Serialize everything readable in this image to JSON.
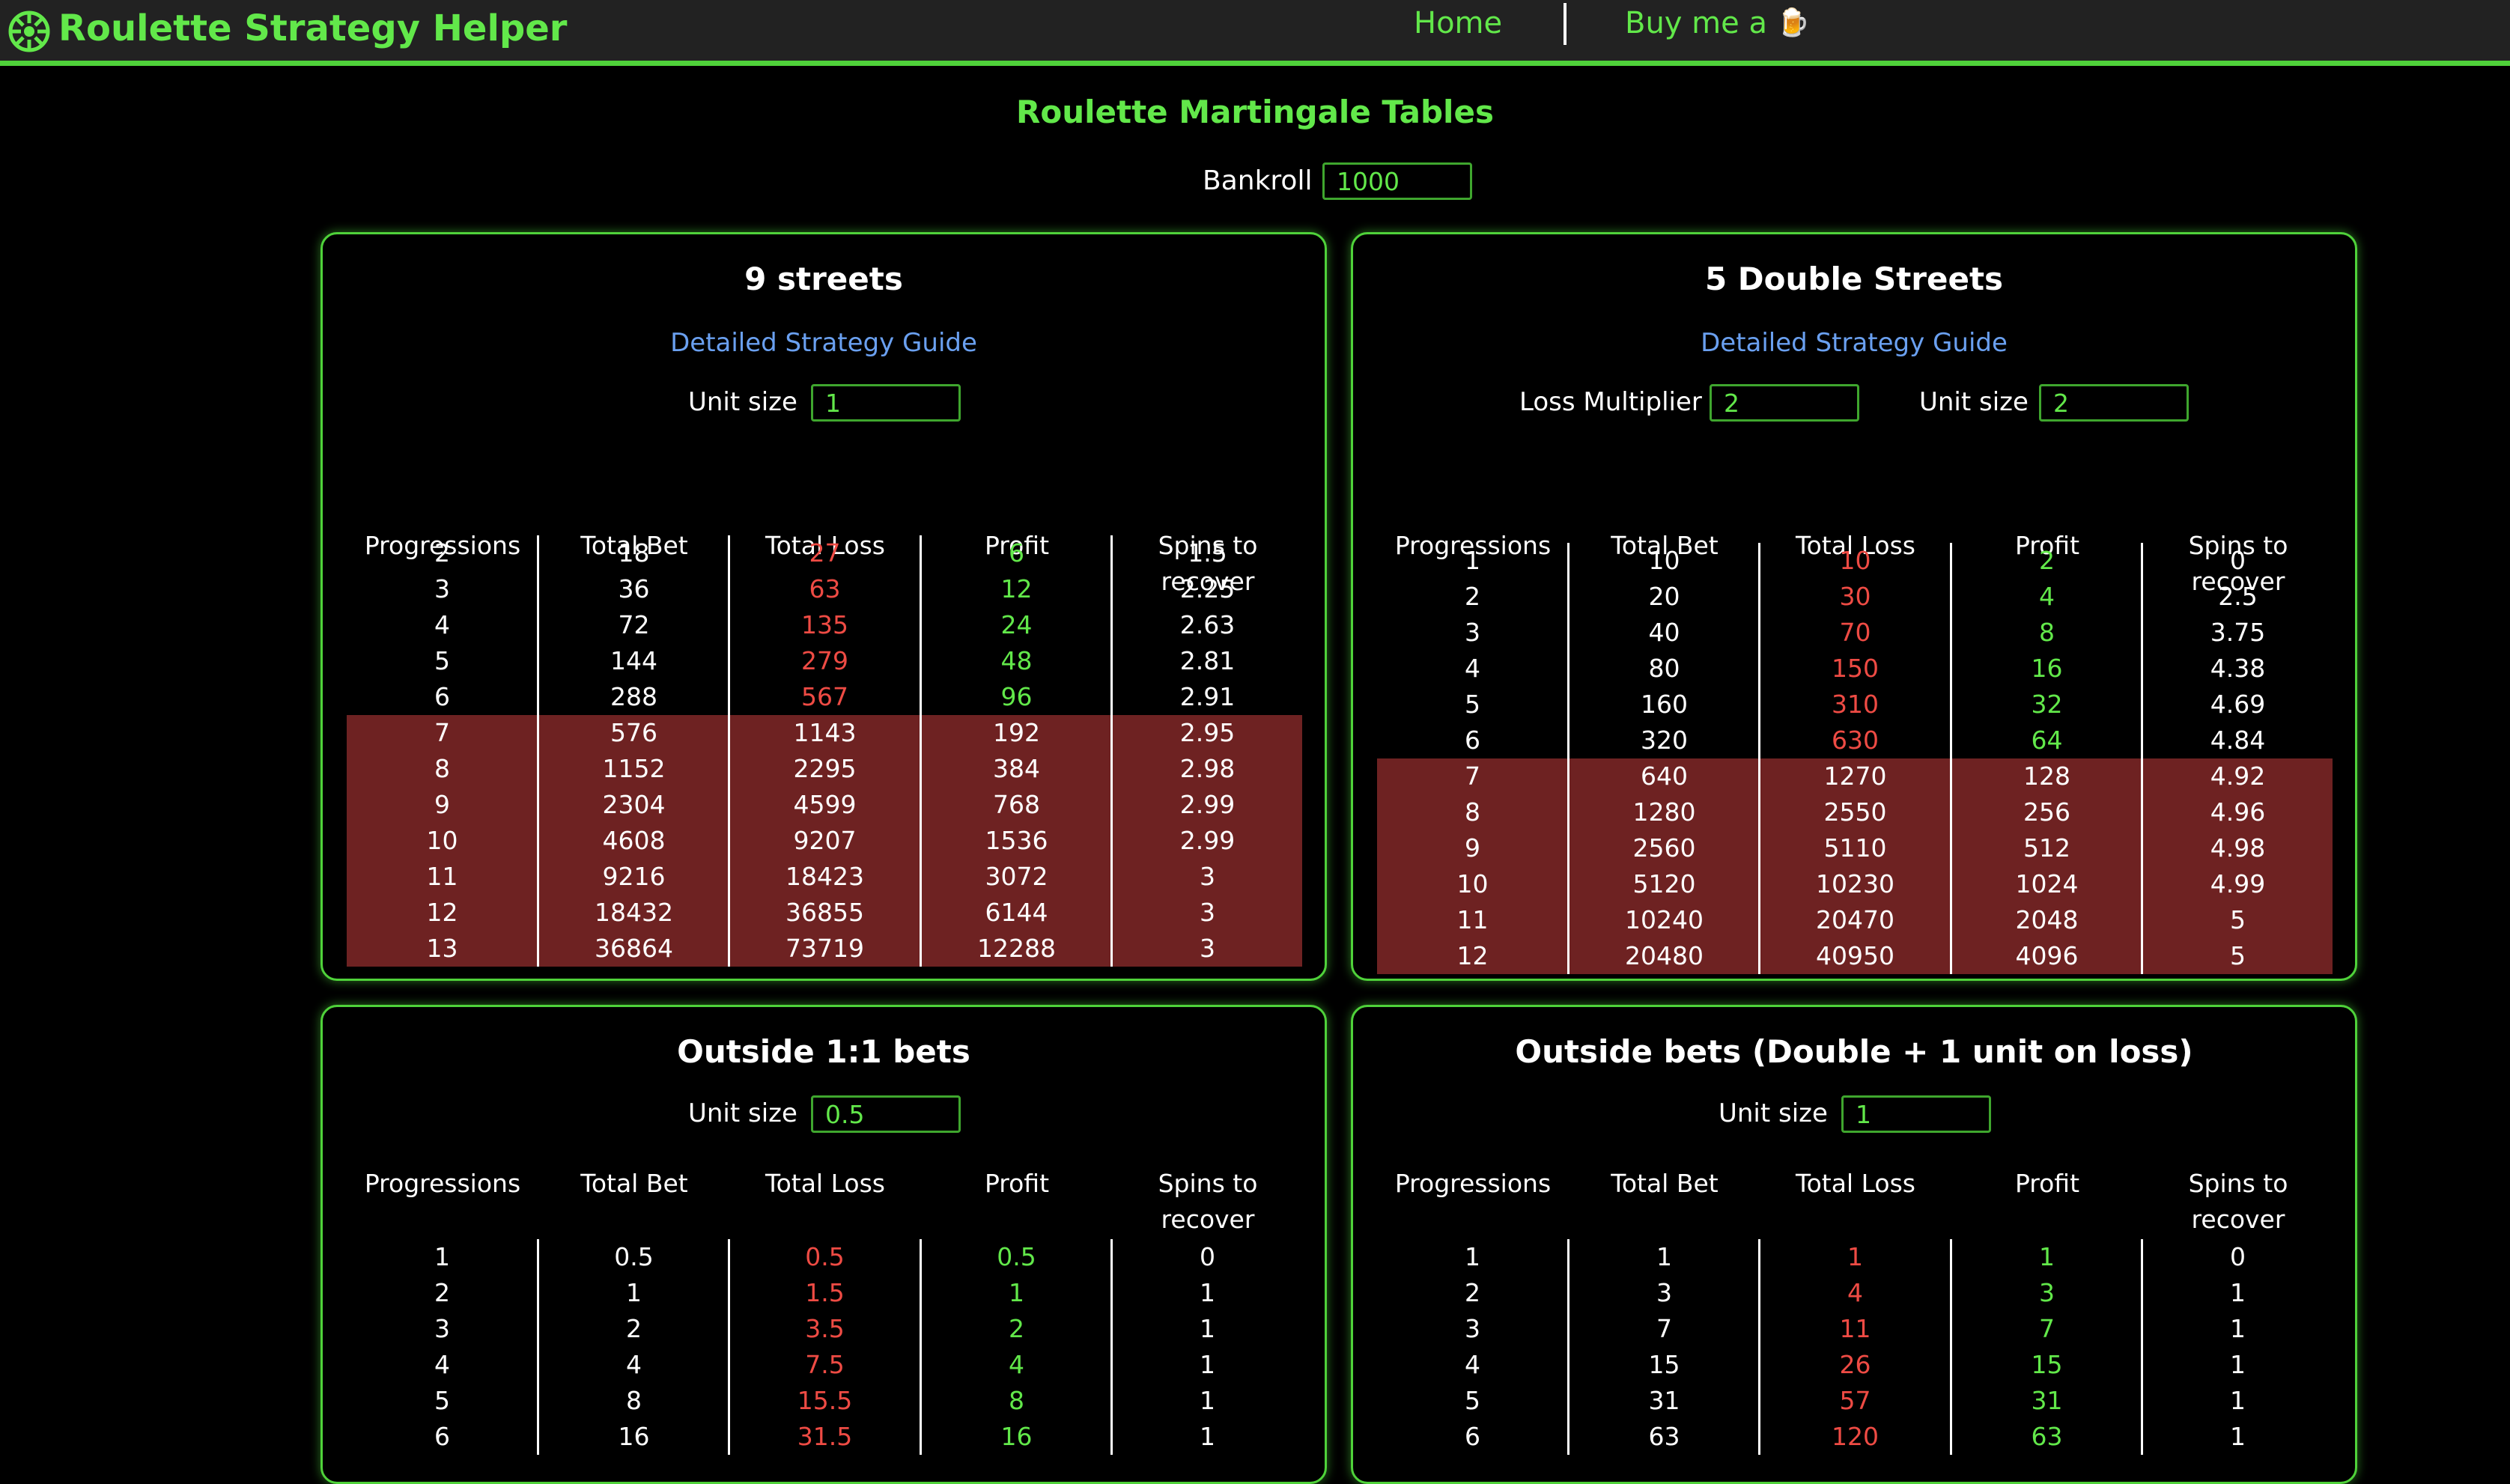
{
  "header": {
    "brand": "Roulette Strategy Helper",
    "nav_home": "Home",
    "nav_buy": "Buy me a",
    "buy_icon": "beer-mug-icon",
    "logo_icon": "roulette-wheel-icon"
  },
  "page": {
    "title": "Roulette Martingale Tables",
    "bankroll_label": "Bankroll",
    "bankroll_value": "1000"
  },
  "colors": {
    "accent": "#62e84a",
    "loss": "#ee4b44",
    "link": "#6aa0f0",
    "highlight_row": "#6e2222",
    "header_bg": "#222222"
  },
  "columns": [
    "Progressions",
    "Total Bet",
    "Total Loss",
    "Profit",
    "Spins to recover"
  ],
  "cards": [
    {
      "title": "9 streets",
      "guide": "Detailed Strategy Guide",
      "unit_label": "Unit size",
      "unit_value": "1",
      "rows": [
        [
          "2",
          "18",
          "27",
          "6",
          "1.5"
        ],
        [
          "3",
          "36",
          "63",
          "12",
          "2.25"
        ],
        [
          "4",
          "72",
          "135",
          "24",
          "2.63"
        ],
        [
          "5",
          "144",
          "279",
          "48",
          "2.81"
        ],
        [
          "6",
          "288",
          "567",
          "96",
          "2.91"
        ],
        [
          "7",
          "576",
          "1143",
          "192",
          "2.95"
        ],
        [
          "8",
          "1152",
          "2295",
          "384",
          "2.98"
        ],
        [
          "9",
          "2304",
          "4599",
          "768",
          "2.99"
        ],
        [
          "10",
          "4608",
          "9207",
          "1536",
          "2.99"
        ],
        [
          "11",
          "9216",
          "18423",
          "3072",
          "3"
        ],
        [
          "12",
          "18432",
          "36855",
          "6144",
          "3"
        ],
        [
          "13",
          "36864",
          "73719",
          "12288",
          "3"
        ]
      ],
      "highlight_from": 5
    },
    {
      "title": "5 Double Streets",
      "guide": "Detailed Strategy Guide",
      "loss_label": "Loss Multiplier",
      "loss_value": "2",
      "unit_label": "Unit size",
      "unit_value": "2",
      "rows": [
        [
          "1",
          "10",
          "10",
          "2",
          "0"
        ],
        [
          "2",
          "20",
          "30",
          "4",
          "2.5"
        ],
        [
          "3",
          "40",
          "70",
          "8",
          "3.75"
        ],
        [
          "4",
          "80",
          "150",
          "16",
          "4.38"
        ],
        [
          "5",
          "160",
          "310",
          "32",
          "4.69"
        ],
        [
          "6",
          "320",
          "630",
          "64",
          "4.84"
        ],
        [
          "7",
          "640",
          "1270",
          "128",
          "4.92"
        ],
        [
          "8",
          "1280",
          "2550",
          "256",
          "4.96"
        ],
        [
          "9",
          "2560",
          "5110",
          "512",
          "4.98"
        ],
        [
          "10",
          "5120",
          "10230",
          "1024",
          "4.99"
        ],
        [
          "11",
          "10240",
          "20470",
          "2048",
          "5"
        ],
        [
          "12",
          "20480",
          "40950",
          "4096",
          "5"
        ]
      ],
      "highlight_from": 6
    },
    {
      "title": "Outside 1:1 bets",
      "unit_label": "Unit size",
      "unit_value": "0.5",
      "rows": [
        [
          "1",
          "0.5",
          "0.5",
          "0.5",
          "0"
        ],
        [
          "2",
          "1",
          "1.5",
          "1",
          "1"
        ],
        [
          "3",
          "2",
          "3.5",
          "2",
          "1"
        ],
        [
          "4",
          "4",
          "7.5",
          "4",
          "1"
        ],
        [
          "5",
          "8",
          "15.5",
          "8",
          "1"
        ],
        [
          "6",
          "16",
          "31.5",
          "16",
          "1"
        ]
      ],
      "highlight_from": 99
    },
    {
      "title": "Outside bets (Double + 1 unit on loss)",
      "unit_label": "Unit size",
      "unit_value": "1",
      "rows": [
        [
          "1",
          "1",
          "1",
          "1",
          "0"
        ],
        [
          "2",
          "3",
          "4",
          "3",
          "1"
        ],
        [
          "3",
          "7",
          "11",
          "7",
          "1"
        ],
        [
          "4",
          "15",
          "26",
          "15",
          "1"
        ],
        [
          "5",
          "31",
          "57",
          "31",
          "1"
        ],
        [
          "6",
          "63",
          "120",
          "63",
          "1"
        ]
      ],
      "highlight_from": 99
    }
  ]
}
